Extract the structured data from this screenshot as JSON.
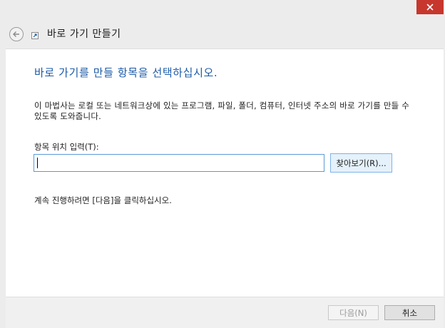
{
  "window": {
    "close_icon": "close-icon",
    "back_icon": "back-arrow-icon",
    "wizard_icon": "shortcut-icon"
  },
  "wizard": {
    "title": "바로 가기 만들기",
    "heading": "바로 가기를 만들 항목을 선택하십시오.",
    "description": "이 마법사는 로컬 또는 네트워크상에 있는 프로그램, 파일, 폴더, 컴퓨터, 인터넷 주소의 바로 가기를 만들 수 있도록 도와줍니다.",
    "location_label": "항목 위치 입력(T):",
    "location_value": "",
    "browse_label": "찾아보기(R)...",
    "continue_text": "계속 진행하려면 [다음]을 클릭하십시오."
  },
  "footer": {
    "next_label": "다음(N)",
    "cancel_label": "취소"
  },
  "colors": {
    "close_red": "#c7372d",
    "heading_blue": "#1c5ba8",
    "input_border": "#5b9bd5",
    "browse_bg": "#e5f1fb"
  }
}
